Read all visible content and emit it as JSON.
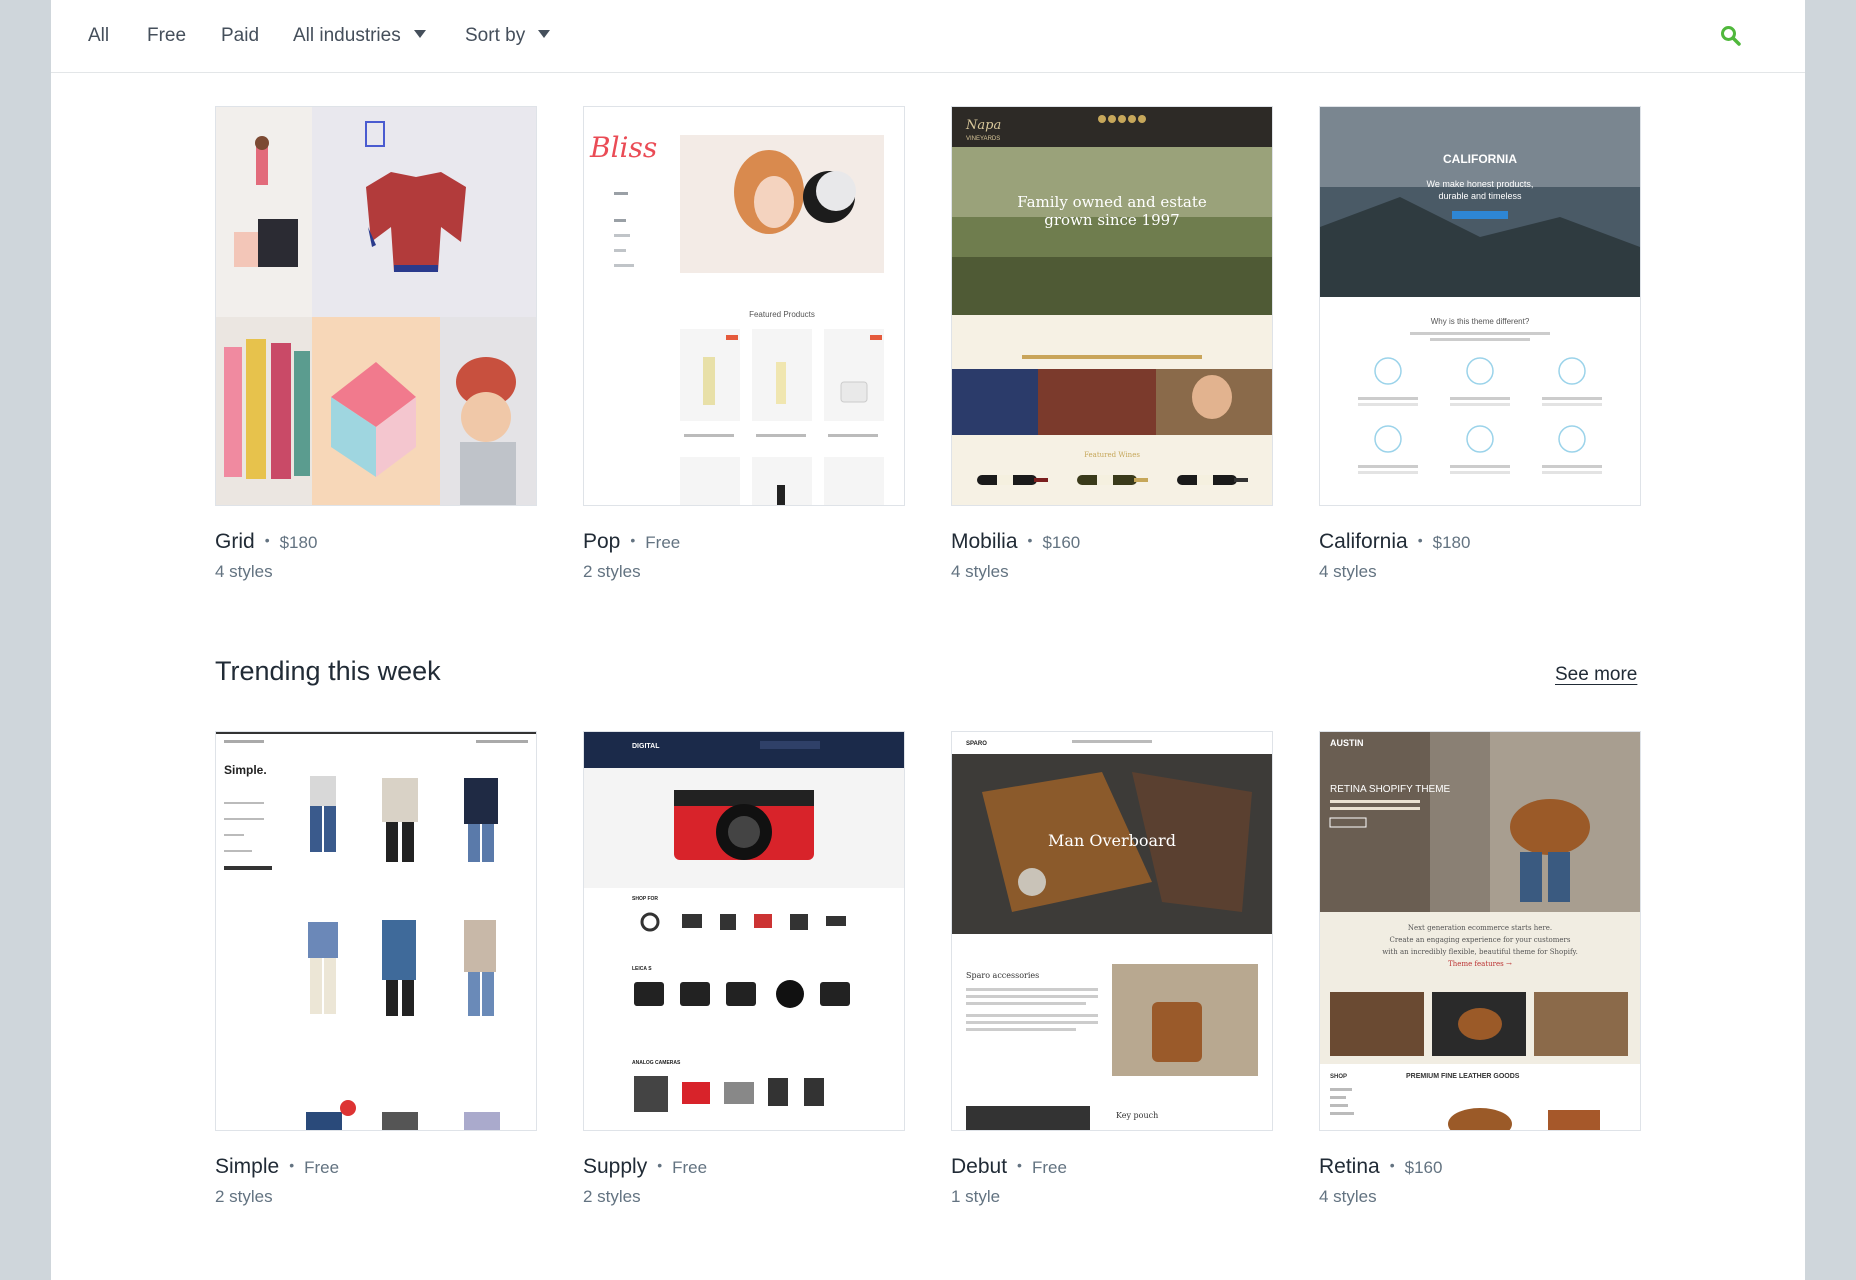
{
  "filters": {
    "all": "All",
    "free": "Free",
    "paid": "Paid",
    "industries": "All industries",
    "sort": "Sort by"
  },
  "icons": {
    "search": "search-icon"
  },
  "colors": {
    "accent_green": "#50b83c"
  },
  "featured": [
    {
      "name": "Grid",
      "price": "$180",
      "styles": "4 styles"
    },
    {
      "name": "Pop",
      "price": "Free",
      "styles": "2 styles"
    },
    {
      "name": "Mobilia",
      "price": "$160",
      "styles": "4 styles"
    },
    {
      "name": "California",
      "price": "$180",
      "styles": "4 styles"
    }
  ],
  "trending": {
    "title": "Trending this week",
    "see_more": "See more",
    "items": [
      {
        "name": "Simple",
        "price": "Free",
        "styles": "2 styles"
      },
      {
        "name": "Supply",
        "price": "Free",
        "styles": "2 styles"
      },
      {
        "name": "Debut",
        "price": "Free",
        "styles": "1 style"
      },
      {
        "name": "Retina",
        "price": "$160",
        "styles": "4 styles"
      }
    ]
  },
  "previews": {
    "pop_logo": "Bliss",
    "pop_section": "Featured Products",
    "mobilia_logo": "Napa",
    "mobilia_logo_sub": "VINEYARDS",
    "mobilia_hero_1": "Family owned and estate",
    "mobilia_hero_2": "grown since 1997",
    "mobilia_featured": "Featured Wines",
    "california_title": "CALIFORNIA",
    "california_tag_1": "We make honest products,",
    "california_tag_2": "durable and timeless",
    "california_why": "Why is this theme different?",
    "simple_logo": "Simple.",
    "supply_logo": "DIGITAL",
    "supply_shop_for": "SHOP FOR",
    "supply_leica": "LEICA S",
    "supply_analog": "ANALOG CAMERAS",
    "debut_logo": "SPARO",
    "debut_hero": "Man Overboard",
    "debut_accessories": "Sparo accessories",
    "debut_keypouch": "Key pouch",
    "retina_logo": "AUSTIN",
    "retina_hero": "RETINA SHOPIFY THEME",
    "retina_text_1": "Next generation ecommerce starts here.",
    "retina_text_2": "Create an engaging experience for your customers",
    "retina_text_3": "with an incredibly flexible, beautiful theme for Shopify.",
    "retina_link": "Theme features →",
    "retina_shop": "SHOP",
    "retina_goods": "PREMIUM FINE LEATHER GOODS"
  }
}
